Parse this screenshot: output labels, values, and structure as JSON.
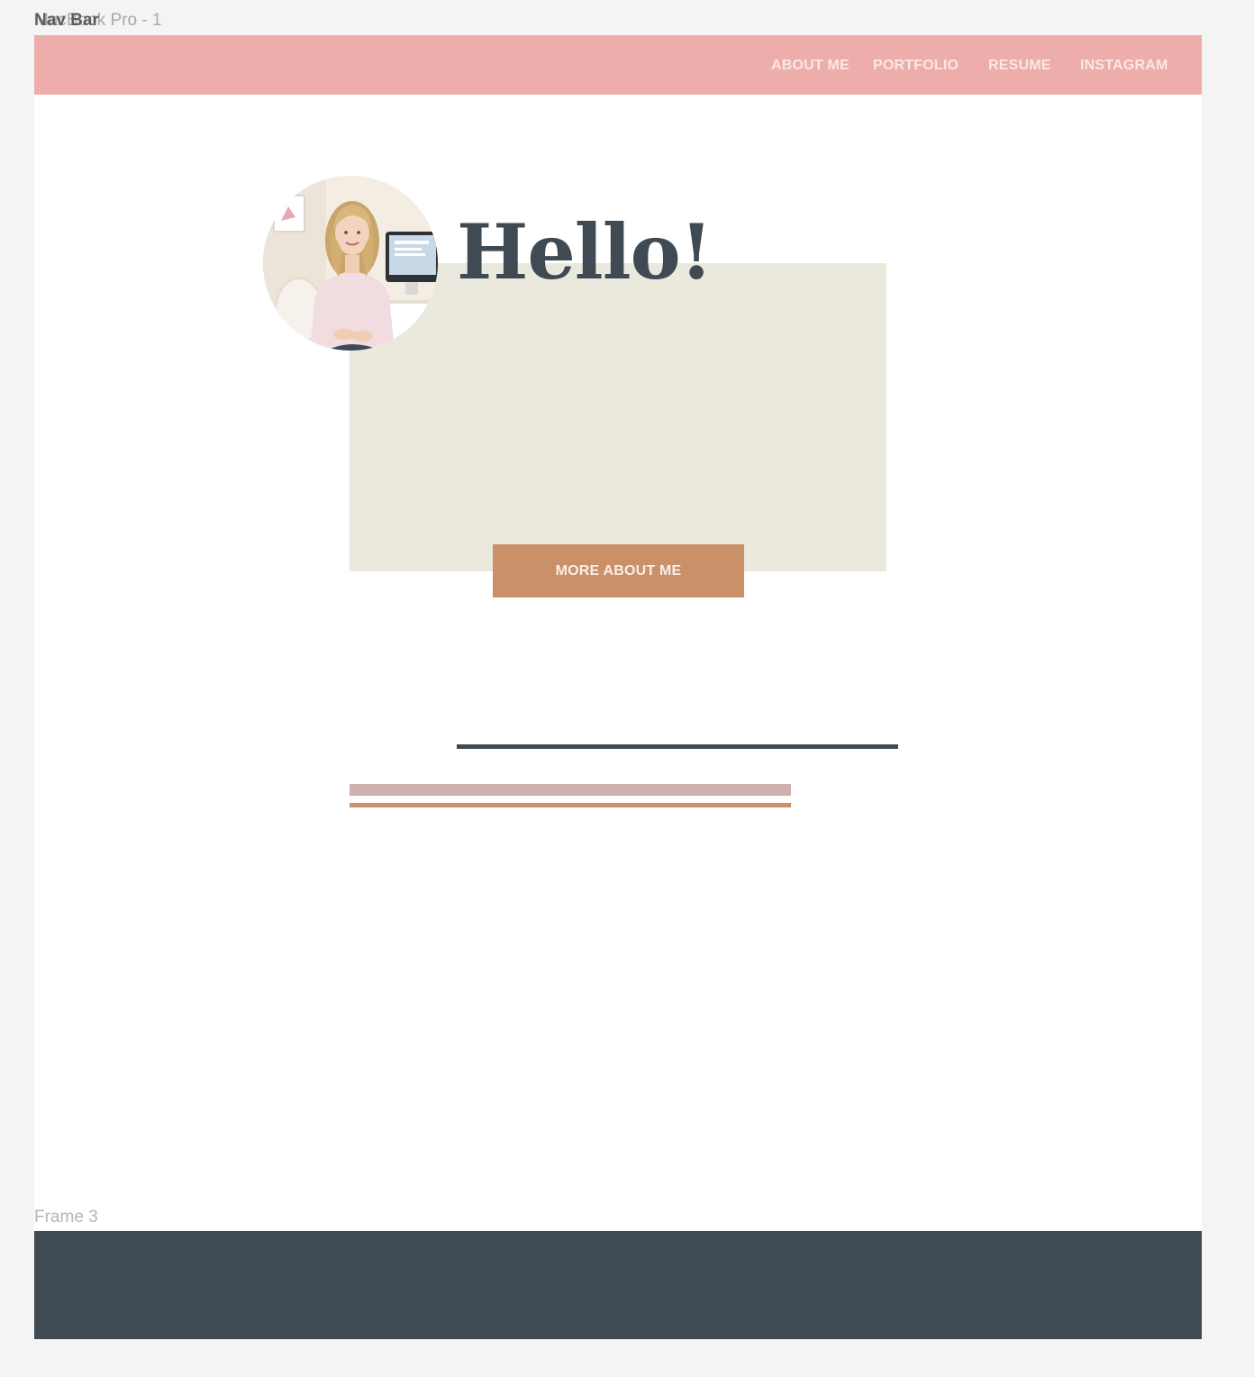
{
  "canvas": {
    "frame_label": "MacBook Pro - 1",
    "navbar_label": "Nav Bar",
    "footer_frame_label": "Frame 3"
  },
  "nav": {
    "items": [
      {
        "label": "ABOUT ME"
      },
      {
        "label": "PORTFOLIO"
      },
      {
        "label": "RESUME"
      },
      {
        "label": "INSTAGRAM"
      }
    ]
  },
  "hero": {
    "greeting": "Hello!",
    "cta_label": "MORE ABOUT ME",
    "avatar_icon": "profile-photo"
  },
  "colors": {
    "canvas_bg": "#f4f4f4",
    "navbar_bg": "#edaeab",
    "nav_text": "#fbe7e4",
    "beige_box": "#ebe9de",
    "heading": "#3f4a52",
    "button_bg": "#c9906a",
    "button_text": "#fbeee6",
    "rule_dark": "#3f4a52",
    "rule_mauve": "#d0b1ad",
    "rule_copper": "#c9906a",
    "footer_bg": "#3f4a52"
  }
}
